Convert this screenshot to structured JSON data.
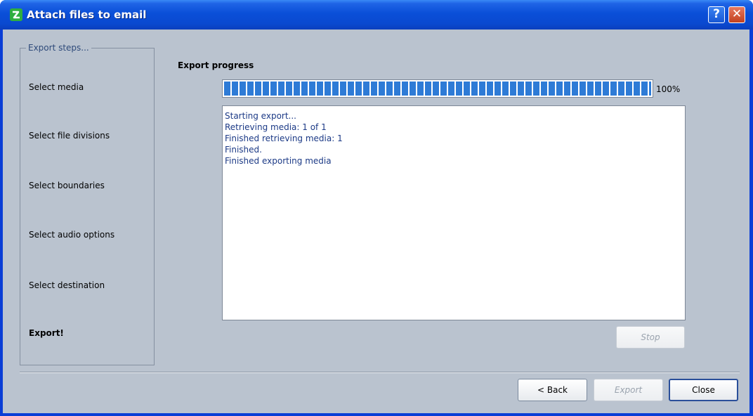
{
  "window": {
    "title": "Attach files to email",
    "help_glyph": "?",
    "close_glyph": "✕",
    "app_icon": "app-logo-icon"
  },
  "steps": {
    "legend": "Export steps...",
    "items": [
      {
        "label": "Select media"
      },
      {
        "label": "Select file divisions"
      },
      {
        "label": "Select boundaries"
      },
      {
        "label": "Select audio options"
      },
      {
        "label": "Select destination"
      },
      {
        "label": "Export!",
        "active": true
      }
    ]
  },
  "progress": {
    "label": "Export progress",
    "value": 1.0,
    "percent_text": "100%"
  },
  "log": {
    "lines": [
      "Starting export...",
      "Retrieving media: 1 of 1",
      "Finished retrieving media: 1",
      "Finished.",
      "Finished exporting media"
    ]
  },
  "buttons": {
    "stop": "Stop",
    "back": "< Back",
    "export": "Export",
    "close": "Close"
  },
  "colors": {
    "titlebar": "#0a4fd8",
    "client_bg": "#bac3cf",
    "progress_fill": "#2e7bd6",
    "log_text": "#1c3a86"
  }
}
